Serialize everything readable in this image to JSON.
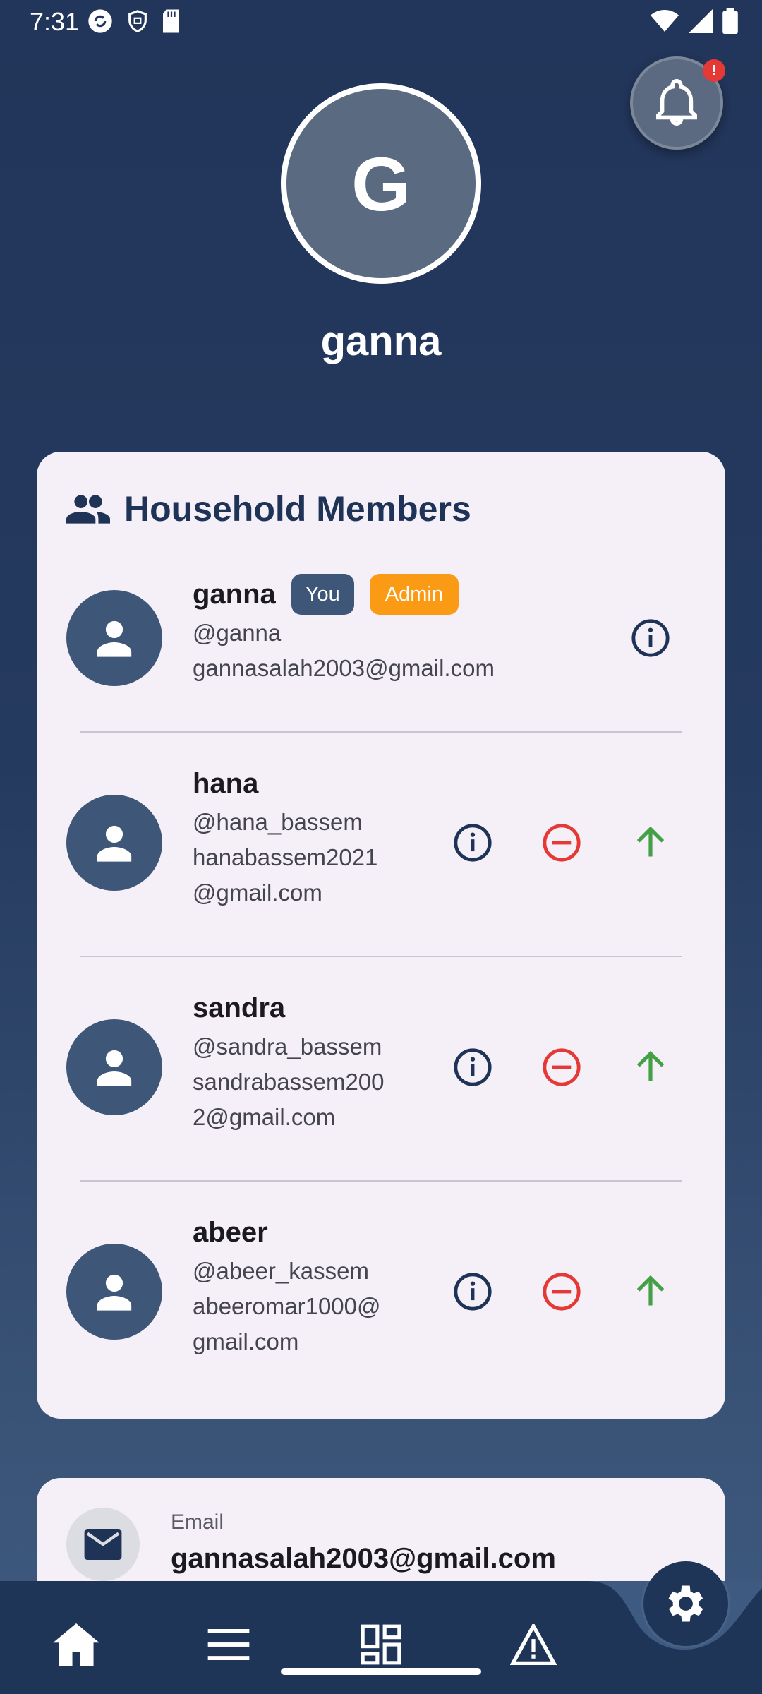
{
  "status_bar": {
    "time": "7:31",
    "left_icons": [
      "sync-icon",
      "shield-icon",
      "sd-card-icon"
    ],
    "right_icons": [
      "wifi-icon",
      "signal-icon",
      "battery-icon"
    ]
  },
  "notifications": {
    "badge": "!"
  },
  "profile": {
    "initial": "G",
    "name": "ganna"
  },
  "members_card": {
    "title": "Household Members",
    "members": [
      {
        "name": "ganna",
        "username": "@ganna",
        "email_lines": [
          "gannasalah2003@gmail.com"
        ],
        "badges": [
          "You",
          "Admin"
        ]
      },
      {
        "name": "hana",
        "username": "@hana_bassem",
        "email_lines": [
          "hanabassem2021",
          "@gmail.com"
        ]
      },
      {
        "name": "sandra",
        "username": "@sandra_bassem",
        "email_lines": [
          "sandrabassem200",
          "2@gmail.com"
        ]
      },
      {
        "name": "abeer",
        "username": "@abeer_kassem",
        "email_lines": [
          "abeeromar1000@",
          "gmail.com"
        ]
      }
    ]
  },
  "email_card": {
    "label": "Email",
    "value": "gannasalah2003@gmail.com"
  },
  "bottom_nav": {
    "items": [
      "home-icon",
      "menu-icon",
      "dashboard-icon",
      "warning-icon"
    ],
    "fab": "settings-icon"
  },
  "colors": {
    "primary": "#1f3558",
    "card": "#f5eff7",
    "danger": "#e53935",
    "promote": "#43a047",
    "admin_badge": "#fb9a14"
  }
}
